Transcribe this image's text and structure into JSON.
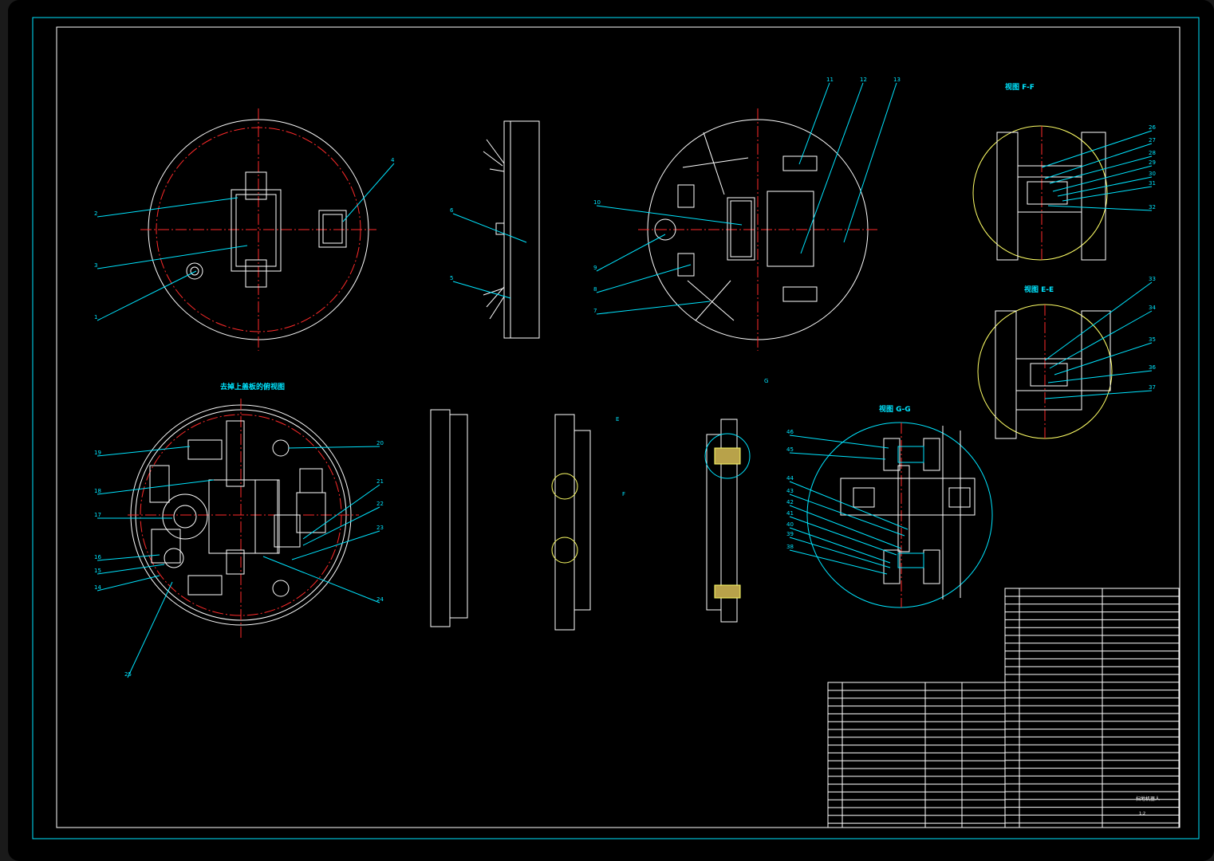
{
  "drawing": {
    "view_titles": {
      "ff": "视图 F-F",
      "ee": "视图 E-E",
      "gg": "视图 G-G",
      "top_section": "去掉上盖板的俯视图"
    },
    "callouts": [
      "1",
      "2",
      "3",
      "4",
      "5",
      "6",
      "7",
      "8",
      "9",
      "10",
      "11",
      "12",
      "13",
      "14",
      "15",
      "16",
      "17",
      "18",
      "19",
      "20",
      "21",
      "22",
      "23",
      "24",
      "25",
      "26",
      "27",
      "28",
      "29",
      "30",
      "31",
      "32",
      "33",
      "34",
      "35",
      "36",
      "37",
      "38",
      "39",
      "40",
      "41",
      "42",
      "43",
      "44",
      "45",
      "46"
    ],
    "section_marks": [
      "E",
      "F",
      "G"
    ],
    "title_block": {
      "name": "扫地机器人",
      "scale": "1:2",
      "material": ""
    }
  },
  "colors": {
    "outline": "#ffffff",
    "frame": "#00e5ff",
    "centerline": "#ff2a2a",
    "highlight": "#ffff66"
  }
}
